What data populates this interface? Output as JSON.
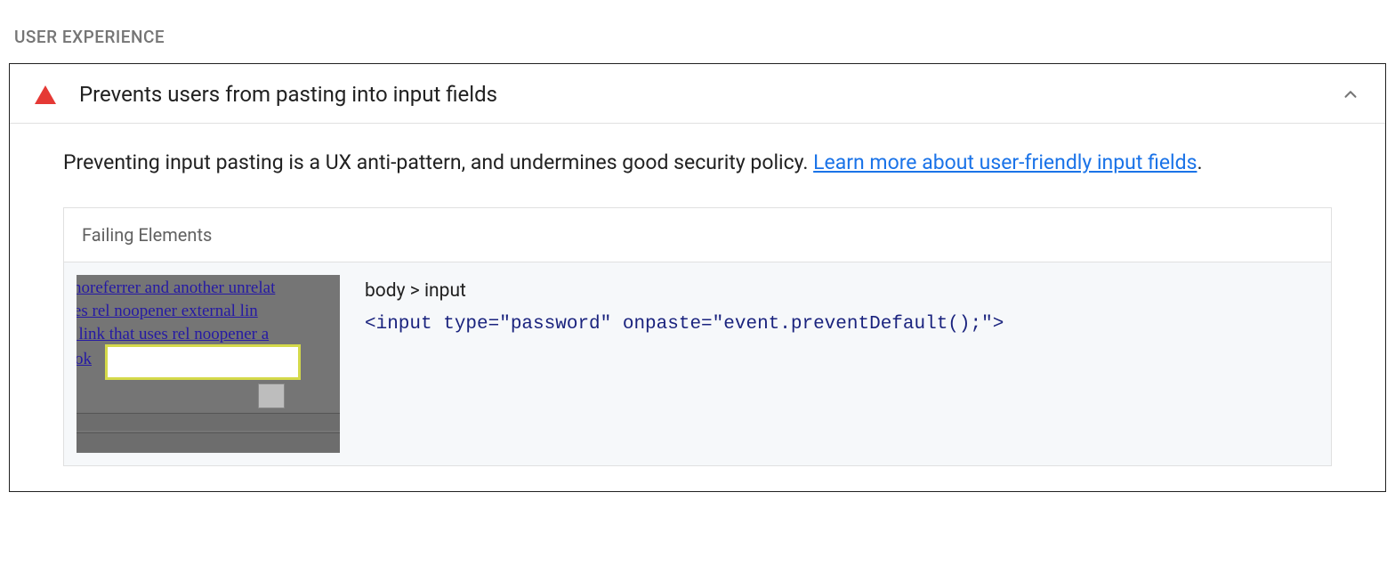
{
  "section": {
    "label": "USER EXPERIENCE"
  },
  "audit": {
    "title": "Prevents users from pasting into input fields",
    "description_pre": "Preventing input pasting is a UX anti-pattern, and undermines good security policy. ",
    "link_text": "Learn more about user-friendly input fields",
    "description_post": ".",
    "failing_header": "Failing Elements",
    "element": {
      "path": "body > input",
      "code": "<input type=\"password\" onpaste=\"event.preventDefault();\">"
    },
    "thumbnail_text": {
      "l1": " noreferrer and another unrelat",
      "l2": "t uses rel noopener external lin",
      "l3": "al link that uses rel noopener a",
      "l4": " ok"
    }
  }
}
